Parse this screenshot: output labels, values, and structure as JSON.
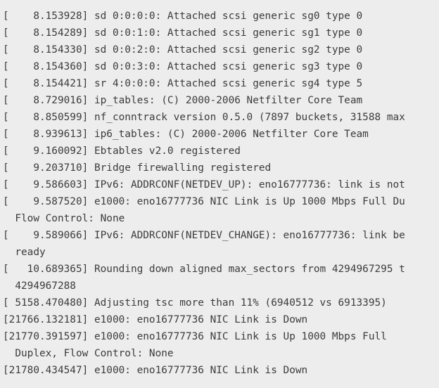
{
  "log_lines": [
    "[    8.153928] sd 0:0:0:0: Attached scsi generic sg0 type 0",
    "[    8.154289] sd 0:0:1:0: Attached scsi generic sg1 type 0",
    "[    8.154330] sd 0:0:2:0: Attached scsi generic sg2 type 0",
    "[    8.154360] sd 0:0:3:0: Attached scsi generic sg3 type 0",
    "[    8.154421] sr 4:0:0:0: Attached scsi generic sg4 type 5",
    "[    8.729016] ip_tables: (C) 2000-2006 Netfilter Core Team",
    "[    8.850599] nf_conntrack version 0.5.0 (7897 buckets, 31588 max",
    "[    8.939613] ip6_tables: (C) 2000-2006 Netfilter Core Team",
    "[    9.160092] Ebtables v2.0 registered",
    "[    9.203710] Bridge firewalling registered",
    "[    9.586603] IPv6: ADDRCONF(NETDEV_UP): eno16777736: link is not",
    "[    9.587520] e1000: eno16777736 NIC Link is Up 1000 Mbps Full Du",
    "  Flow Control: None",
    "[    9.589066] IPv6: ADDRCONF(NETDEV_CHANGE): eno16777736: link be",
    "  ready",
    "[   10.689365] Rounding down aligned max_sectors from 4294967295 t",
    "  4294967288",
    "[ 5158.470480] Adjusting tsc more than 11% (6940512 vs 6913395)",
    "[21766.132181] e1000: eno16777736 NIC Link is Down",
    "[21770.391597] e1000: eno16777736 NIC Link is Up 1000 Mbps Full",
    "  Duplex, Flow Control: None",
    "[21780.434547] e1000: eno16777736 NIC Link is Down"
  ]
}
